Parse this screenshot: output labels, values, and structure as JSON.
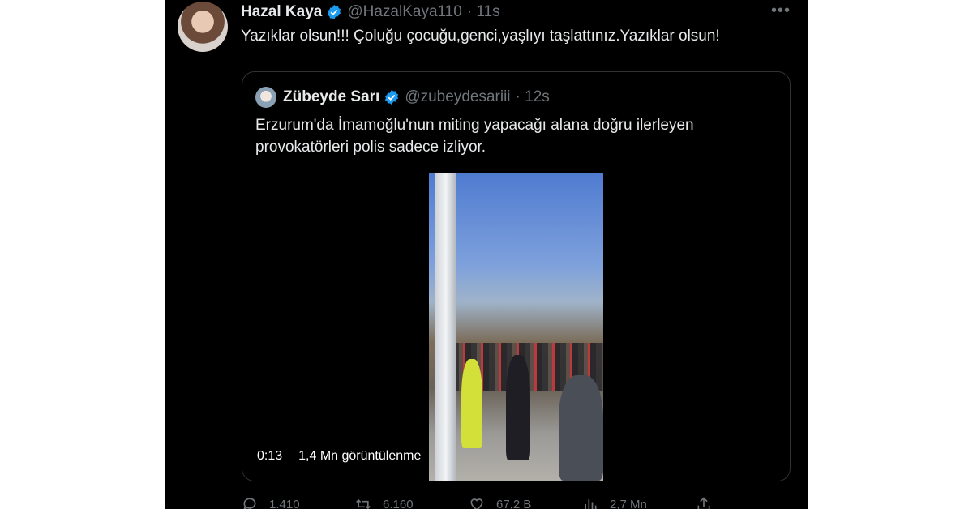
{
  "author": {
    "name": "Hazal Kaya",
    "handle": "@HazalKaya110",
    "time": "· 11s",
    "text": "Yazıklar olsun!!! Çoluğu çocuğu,genci,yaşlıyı taşlattınız.Yazıklar olsun!"
  },
  "quoted": {
    "name": "Zübeyde Sarı",
    "handle": "@zubeydesariii",
    "time": "· 12s",
    "text": "Erzurum'da İmamoğlu'nun miting yapacağı alana doğru ilerleyen provokatörleri polis sadece izliyor."
  },
  "video": {
    "duration": "0:13",
    "views": "1,4 Mn görüntülenme"
  },
  "actions": {
    "replies": "1.410",
    "reposts": "6.160",
    "likes": "67,2 B",
    "views": "2,7 Mn"
  },
  "icons": [
    "verified-badge-icon",
    "more-icon",
    "reply-icon",
    "repost-icon",
    "like-icon",
    "views-icon",
    "share-icon"
  ],
  "colors": {
    "background": "#000000",
    "text": "#e7e9ea",
    "muted": "#71767b",
    "verified": "#1d9bf0"
  }
}
